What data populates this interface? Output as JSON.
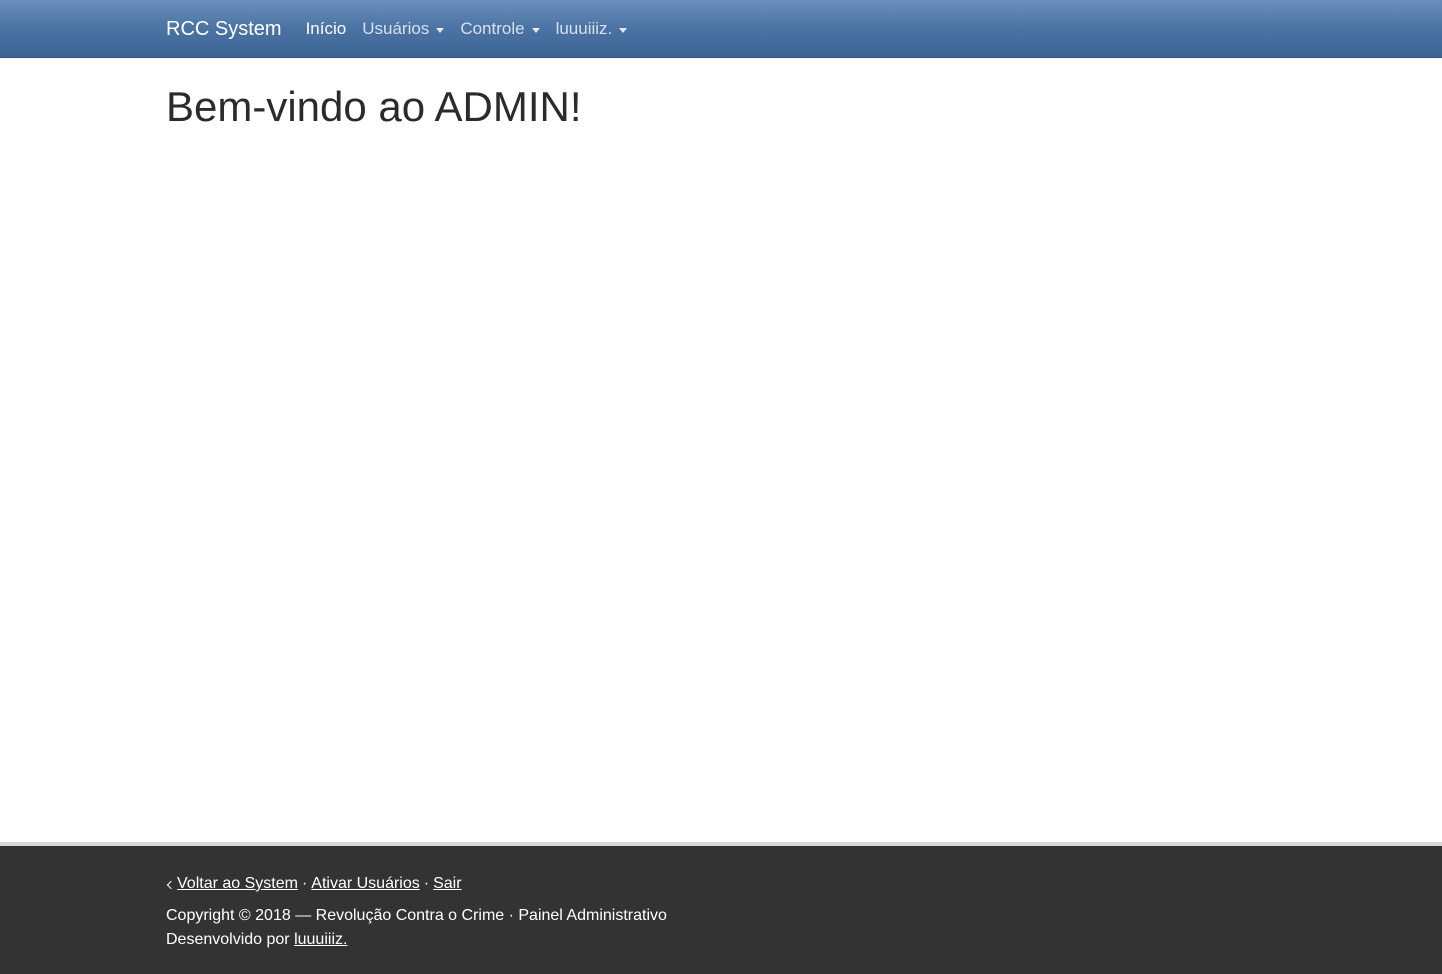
{
  "navbar": {
    "brand": "RCC System",
    "items": [
      {
        "label": "Início",
        "active": true,
        "dropdown": false
      },
      {
        "label": "Usuários",
        "active": false,
        "dropdown": true
      },
      {
        "label": "Controle",
        "active": false,
        "dropdown": true
      },
      {
        "label": "luuuiiiz.",
        "active": false,
        "dropdown": true
      }
    ],
    "colors": {
      "gradient_top": "#6a8fbd",
      "gradient_bottom": "#3d6594"
    }
  },
  "main": {
    "title": "Bem-vindo ao ADMIN!"
  },
  "footer": {
    "links": {
      "back": "Voltar ao System",
      "activate": "Ativar Usuários",
      "logout": "Sair"
    },
    "separator": "·",
    "copyright": "Copyright © 2018 — Revolução Contra o Crime · Painel Administrativo",
    "developed_prefix": "Desenvolvido por ",
    "developer": "luuuiiiz.",
    "colors": {
      "background": "#333333"
    }
  }
}
